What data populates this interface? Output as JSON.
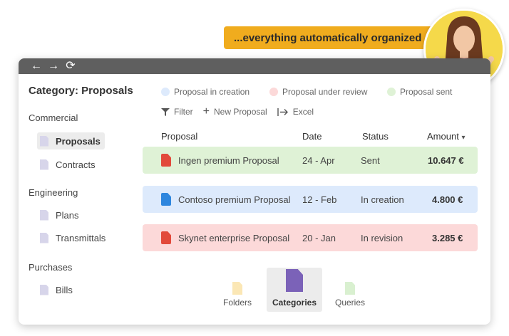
{
  "banner": {
    "text": "...everything automatically organized"
  },
  "colors": {
    "banner": "#f0ac1e",
    "creation": "#ddeafc",
    "review": "#fcd9d9",
    "sent": "#dff2d6",
    "pdf_red": "#e24a3b",
    "docx_blue": "#2e86de"
  },
  "nav": {
    "back": "←",
    "forward": "→",
    "reload": "⟳"
  },
  "sidebar": {
    "title": "Category: Proposals",
    "sections": [
      {
        "label": "Commercial",
        "items": [
          {
            "label": "Proposals"
          },
          {
            "label": "Contracts"
          }
        ]
      },
      {
        "label": "Engineering",
        "items": [
          {
            "label": "Plans"
          },
          {
            "label": "Transmittals"
          }
        ]
      },
      {
        "label": "Purchases",
        "items": [
          {
            "label": "Bills"
          }
        ]
      }
    ]
  },
  "legend": [
    {
      "label": "Proposal in creation",
      "color": "#ddeafc"
    },
    {
      "label": "Proposal under review",
      "color": "#fcd9d9"
    },
    {
      "label": "Proposal sent",
      "color": "#dff2d6"
    }
  ],
  "toolbar": {
    "filter": "Filter",
    "new": "New Proposal",
    "excel": "Excel"
  },
  "table": {
    "headers": {
      "proposal": "Proposal",
      "date": "Date",
      "status": "Status",
      "amount": "Amount",
      "sort_icon": "▾"
    },
    "rows": [
      {
        "name": "Ingen premium Proposal",
        "date": "24 - Apr",
        "status": "Sent",
        "amount": "10.647 €",
        "file": "pdf"
      },
      {
        "name": "Contoso premium Proposal",
        "date": "12 - Feb",
        "status": "In creation",
        "amount": "4.800 €",
        "file": "docx"
      },
      {
        "name": "Skynet enterprise Proposal",
        "date": "20 - Jan",
        "status": "In revision",
        "amount": "3.285 €",
        "file": "pdf"
      }
    ]
  },
  "views": [
    {
      "label": "Folders"
    },
    {
      "label": "Categories"
    },
    {
      "label": "Queries"
    }
  ]
}
